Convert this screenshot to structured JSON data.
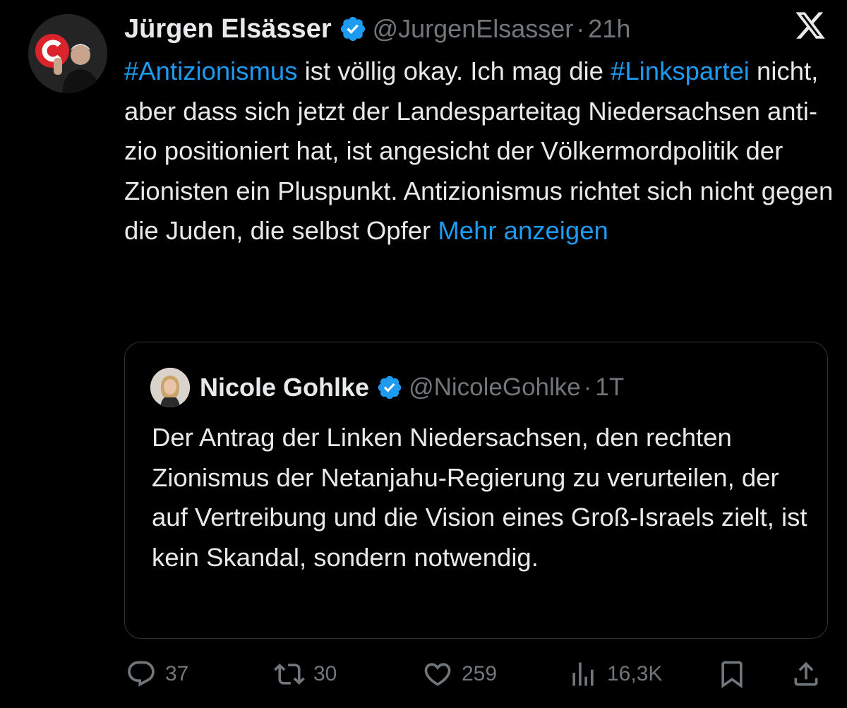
{
  "tweet": {
    "author_name": "Jürgen Elsässer",
    "handle": "@JurgenElsasser",
    "separator": "·",
    "time": "21h",
    "text_parts": {
      "hashtag1": "#Antizionismus",
      "text1": " ist völlig okay. Ich mag die ",
      "hashtag2": "#Linkspartei",
      "text2": " nicht, aber dass sich jetzt der Landesparteitag Niedersachsen anti-zio positioniert hat, ist angesicht der Völkermordpolitik der Zionisten ein Pluspunkt. Antizionismus richtet sich nicht gegen die Juden, die selbst Opfer ",
      "more": "Mehr anzeigen"
    }
  },
  "quote": {
    "author_name": "Nicole Gohlke",
    "handle": "@NicoleGohlke",
    "separator": "·",
    "time": "1T",
    "text": "Der Antrag der Linken Niedersachsen, den rechten Zionismus der Netanjahu-Regierung zu verurteilen, der  auf Vertreibung und die Vision eines Groß-Israels zielt, ist kein Skandal, sondern notwendig."
  },
  "actions": {
    "replies": "37",
    "reposts": "30",
    "likes": "259",
    "views": "16,3K"
  },
  "icons": {
    "logo": "x-logo-icon",
    "verified": "verified-badge-icon",
    "reply": "reply-icon",
    "repost": "repost-icon",
    "like": "heart-icon",
    "views": "views-icon",
    "bookmark": "bookmark-icon",
    "share": "share-icon"
  },
  "colors": {
    "background": "#000000",
    "text": "#e7e9ea",
    "muted": "#71767b",
    "link": "#1d9bf0",
    "border": "#2f3336"
  }
}
